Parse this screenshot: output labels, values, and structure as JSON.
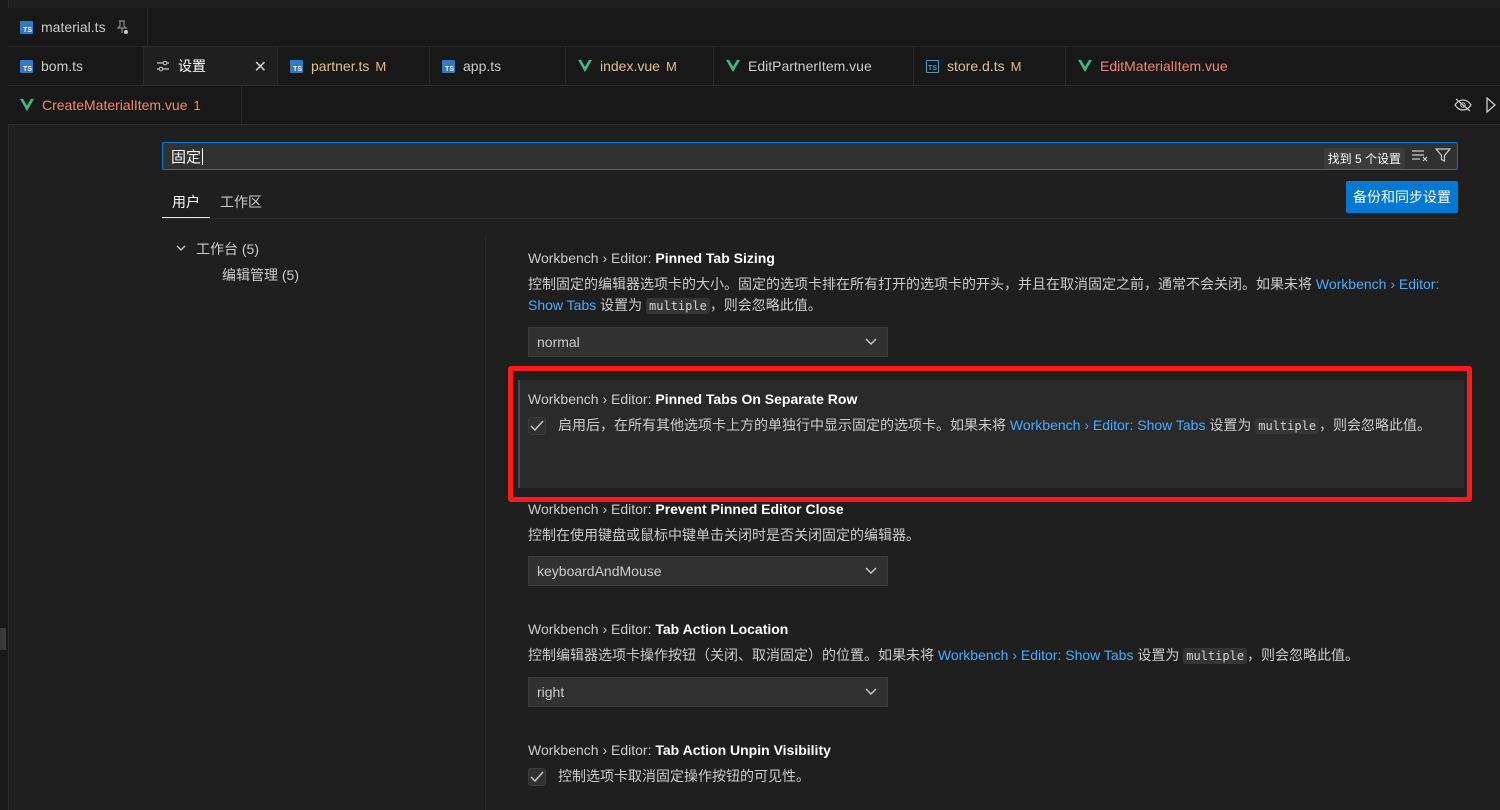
{
  "tabs_row1": [
    {
      "label": "material.ts"
    }
  ],
  "tabs_row2": [
    {
      "label": "bom.ts"
    },
    {
      "label": "设置"
    },
    {
      "label": "partner.ts",
      "status": "M"
    },
    {
      "label": "app.ts"
    },
    {
      "label": "index.vue",
      "status": "M"
    },
    {
      "label": "EditPartnerItem.vue"
    },
    {
      "label": "store.d.ts",
      "status": "M"
    },
    {
      "label": "EditMaterialItem.vue"
    }
  ],
  "tabs_row3": [
    {
      "label": "CreateMaterialItem.vue",
      "status": "1"
    }
  ],
  "search": {
    "value": "固定",
    "count": "找到 5 个设置"
  },
  "scope_tabs": {
    "user": "用户",
    "workspace": "工作区"
  },
  "sync_button": "备份和同步设置",
  "toc": {
    "group": "工作台 (5)",
    "child": "编辑管理 (5)"
  },
  "settings": [
    {
      "prefix": "Workbench › Editor: ",
      "name": "Pinned Tab Sizing",
      "desc_a": "控制固定的编辑器选项卡的大小。固定的选项卡排在所有打开的选项卡的开头，并且在取消固定之前，通常不会关闭。如果未将 ",
      "link": "Workbench › Editor: Show Tabs",
      "desc_b": " 设置为 ",
      "code": "multiple",
      "desc_c": "，则会忽略此值。",
      "value": "normal"
    },
    {
      "prefix": "Workbench › Editor: ",
      "name": "Pinned Tabs On Separate Row",
      "desc_a": "启用后，在所有其他选项卡上方的单独行中显示固定的选项卡。如果未将 ",
      "link": "Workbench › Editor: Show Tabs",
      "desc_b": " 设置为 ",
      "code": "multiple",
      "desc_c": "，则会忽略此值。"
    },
    {
      "prefix": "Workbench › Editor: ",
      "name": "Prevent Pinned Editor Close",
      "desc_a": "控制在使用键盘或鼠标中键单击关闭时是否关闭固定的编辑器。",
      "value": "keyboardAndMouse"
    },
    {
      "prefix": "Workbench › Editor: ",
      "name": "Tab Action Location",
      "desc_a": "控制编辑器选项卡操作按钮（关闭、取消固定）的位置。如果未将 ",
      "link": "Workbench › Editor: Show Tabs",
      "desc_b": " 设置为 ",
      "code": "multiple",
      "desc_c": "，则会忽略此值。",
      "value": "right"
    },
    {
      "prefix": "Workbench › Editor: ",
      "name": "Tab Action Unpin Visibility",
      "desc_a": "控制选项卡取消固定操作按钮的可见性。"
    }
  ],
  "colors": {
    "accent": "#0078d4",
    "highlight": "#ff1a1a",
    "link": "#4daafc",
    "modified": "#e2c08d",
    "error": "#f48771"
  }
}
